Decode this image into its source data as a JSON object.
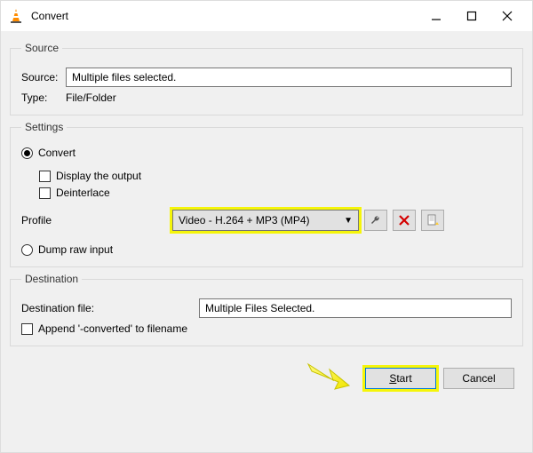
{
  "window": {
    "title": "Convert"
  },
  "source": {
    "legend": "Source",
    "source_label": "Source:",
    "source_value": "Multiple files selected.",
    "type_label": "Type:",
    "type_value": "File/Folder"
  },
  "settings": {
    "legend": "Settings",
    "convert_label": "Convert",
    "display_output_label": "Display the output",
    "deinterlace_label": "Deinterlace",
    "profile_label": "Profile",
    "profile_value": "Video - H.264 + MP3 (MP4)",
    "dump_raw_label": "Dump raw input"
  },
  "destination": {
    "legend": "Destination",
    "dest_file_label": "Destination file:",
    "dest_file_value": "Multiple Files Selected.",
    "append_label": "Append '-converted' to filename"
  },
  "actions": {
    "start": "Start",
    "cancel": "Cancel"
  },
  "icons": {
    "tools": "tools-icon",
    "delete": "delete-icon",
    "new_profile": "new-profile-icon"
  }
}
